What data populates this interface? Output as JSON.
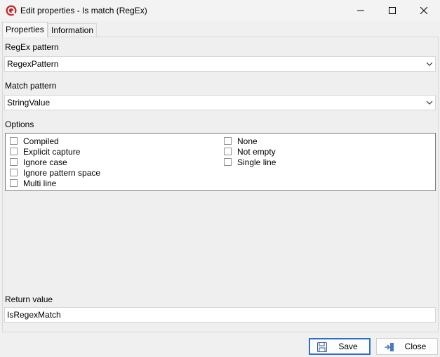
{
  "window": {
    "title": "Edit properties - Is match (RegEx)",
    "app_icon": "app-logo-icon",
    "controls": [
      "minimize-icon",
      "maximize-icon",
      "close-icon"
    ]
  },
  "tabs": [
    {
      "label": "Properties",
      "active": true
    },
    {
      "label": "Information",
      "active": false
    }
  ],
  "fields": {
    "regex_pattern": {
      "label": "RegEx pattern",
      "value": "RegexPattern"
    },
    "match_pattern": {
      "label": "Match pattern",
      "value": "StringValue"
    },
    "return_value": {
      "label": "Return value",
      "value": "IsRegexMatch"
    }
  },
  "options": {
    "label": "Options",
    "left_column": [
      {
        "label": "Compiled",
        "checked": false
      },
      {
        "label": "Explicit capture",
        "checked": false
      },
      {
        "label": "Ignore case",
        "checked": false
      },
      {
        "label": "Ignore pattern space",
        "checked": false
      },
      {
        "label": "Multi line",
        "checked": false
      }
    ],
    "right_column": [
      {
        "label": "None",
        "checked": false
      },
      {
        "label": "Not empty",
        "checked": false
      },
      {
        "label": "Single line",
        "checked": false
      }
    ]
  },
  "buttons": {
    "save": {
      "label": "Save",
      "icon": "floppy-disk-icon"
    },
    "close": {
      "label": "Close",
      "icon": "exit-arrow-icon"
    }
  },
  "colors": {
    "accent": "#2a6fd0",
    "app_icon": "#c8262b"
  }
}
